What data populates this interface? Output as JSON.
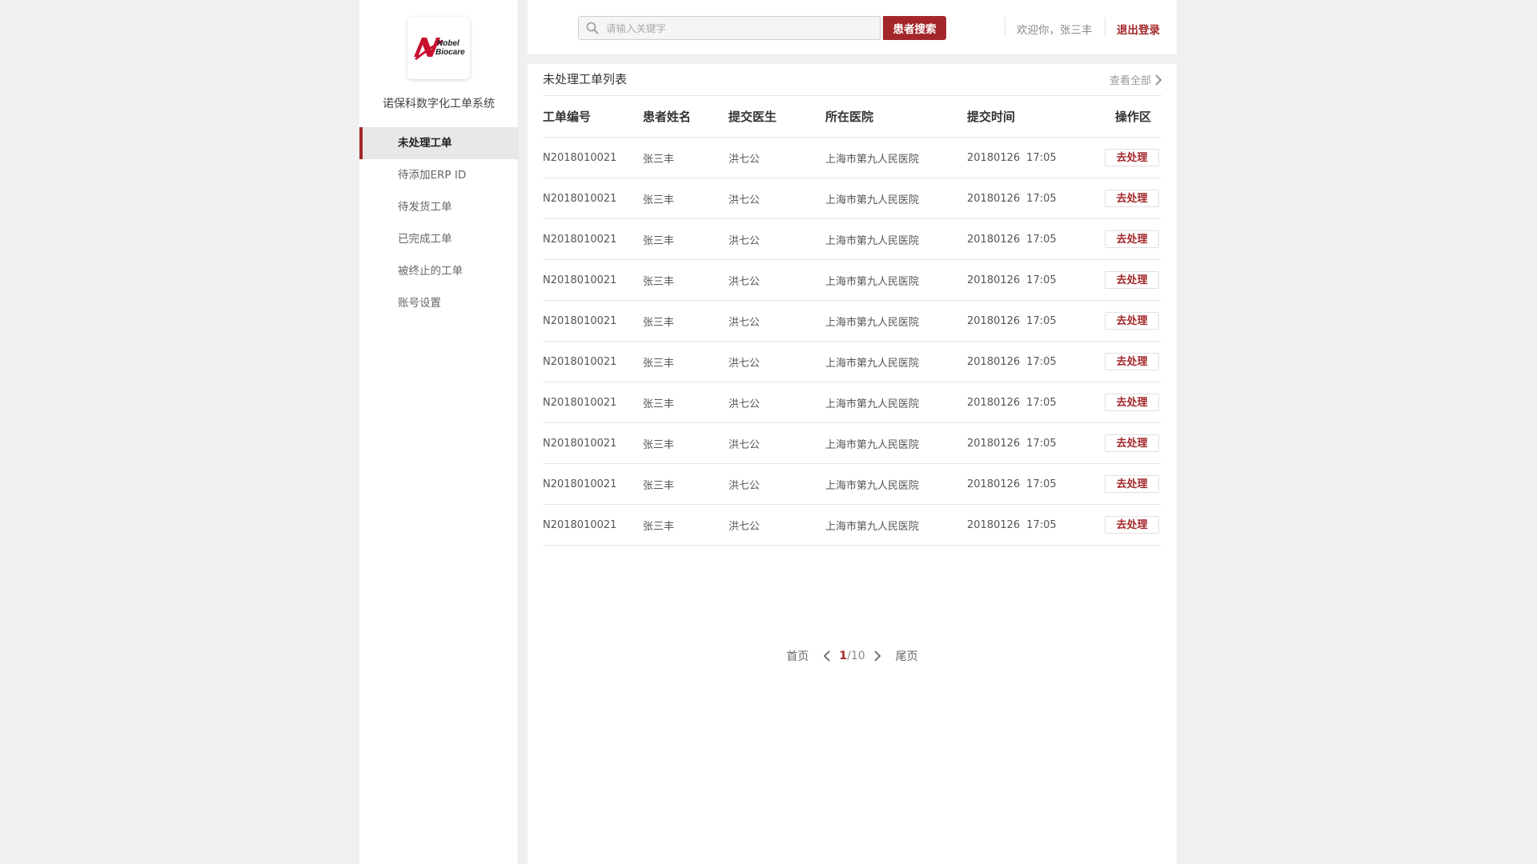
{
  "sidebar": {
    "logo_text_line1": "Nobel",
    "logo_text_line2": "Biocare",
    "system_name": "诺保科数字化工单系统",
    "items": [
      {
        "label": "未处理工单",
        "active": true
      },
      {
        "label": "待添加ERP ID",
        "active": false
      },
      {
        "label": "待发货工单",
        "active": false
      },
      {
        "label": "已完成工单",
        "active": false
      },
      {
        "label": "被终止的工单",
        "active": false
      },
      {
        "label": "账号设置",
        "active": false
      }
    ]
  },
  "header": {
    "search_placeholder": "请输入关键字",
    "search_button": "患者搜索",
    "welcome": "欢迎你，张三丰",
    "logout": "退出登录"
  },
  "main": {
    "title": "未处理工单列表",
    "view_all": "查看全部",
    "columns": [
      "工单编号",
      "患者姓名",
      "提交医生",
      "所在医院",
      "提交时间",
      "操作区"
    ],
    "rows": [
      {
        "id": "N2018010021",
        "patient": "张三丰",
        "doctor": "洪七公",
        "hospital": "上海市第九人民医院",
        "date": "20180126",
        "time": "17:05",
        "action": "去处理"
      },
      {
        "id": "N2018010021",
        "patient": "张三丰",
        "doctor": "洪七公",
        "hospital": "上海市第九人民医院",
        "date": "20180126",
        "time": "17:05",
        "action": "去处理"
      },
      {
        "id": "N2018010021",
        "patient": "张三丰",
        "doctor": "洪七公",
        "hospital": "上海市第九人民医院",
        "date": "20180126",
        "time": "17:05",
        "action": "去处理"
      },
      {
        "id": "N2018010021",
        "patient": "张三丰",
        "doctor": "洪七公",
        "hospital": "上海市第九人民医院",
        "date": "20180126",
        "time": "17:05",
        "action": "去处理"
      },
      {
        "id": "N2018010021",
        "patient": "张三丰",
        "doctor": "洪七公",
        "hospital": "上海市第九人民医院",
        "date": "20180126",
        "time": "17:05",
        "action": "去处理"
      },
      {
        "id": "N2018010021",
        "patient": "张三丰",
        "doctor": "洪七公",
        "hospital": "上海市第九人民医院",
        "date": "20180126",
        "time": "17:05",
        "action": "去处理"
      },
      {
        "id": "N2018010021",
        "patient": "张三丰",
        "doctor": "洪七公",
        "hospital": "上海市第九人民医院",
        "date": "20180126",
        "time": "17:05",
        "action": "去处理"
      },
      {
        "id": "N2018010021",
        "patient": "张三丰",
        "doctor": "洪七公",
        "hospital": "上海市第九人民医院",
        "date": "20180126",
        "time": "17:05",
        "action": "去处理"
      },
      {
        "id": "N2018010021",
        "patient": "张三丰",
        "doctor": "洪七公",
        "hospital": "上海市第九人民医院",
        "date": "20180126",
        "time": "17:05",
        "action": "去处理"
      },
      {
        "id": "N2018010021",
        "patient": "张三丰",
        "doctor": "洪七公",
        "hospital": "上海市第九人民医院",
        "date": "20180126",
        "time": "17:05",
        "action": "去处理"
      }
    ]
  },
  "pagination": {
    "first": "首页",
    "current": "1",
    "separator": "/",
    "total": "10",
    "last": "尾页"
  },
  "colors": {
    "accent": "#a3272a",
    "background": "#f0f0f0",
    "panel": "#ffffff"
  },
  "icons": {
    "logo": "nobel-biocare-logo",
    "search": "search-icon",
    "view_all_arrow": "chevron-right-icon",
    "prev_page": "chevron-left-icon",
    "next_page": "chevron-right-icon"
  }
}
